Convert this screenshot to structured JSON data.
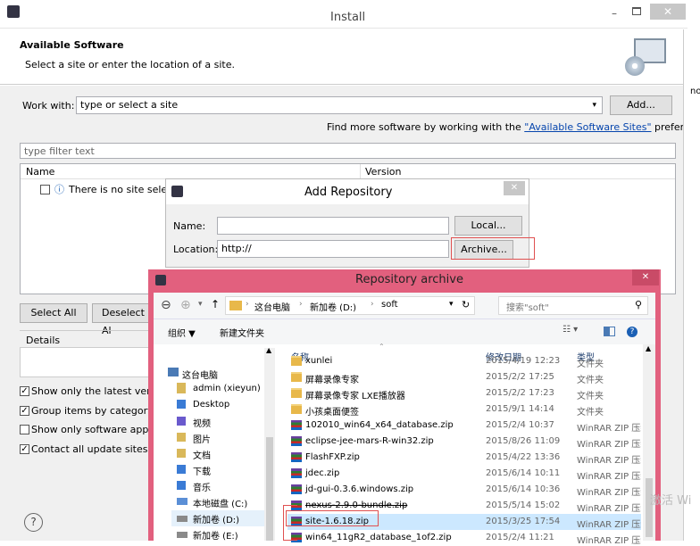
{
  "install": {
    "title": "Install",
    "header_title": "Available Software",
    "header_subtitle": "Select a site or enter the location of a site.",
    "work_with_label": "Work with:",
    "work_with_value": "type or select a site",
    "add_button": "Add...",
    "find_more_prefix": "Find more software by working with the ",
    "find_more_link": "\"Available Software Sites\"",
    "find_more_suffix": " preferences.",
    "filter_placeholder": "type filter text",
    "col_name": "Name",
    "col_version": "Version",
    "no_site_text": "There is no site select",
    "select_all": "Select All",
    "deselect_all": "Deselect Al",
    "details_label": "Details",
    "options": [
      {
        "label": "Show only the latest versio",
        "checked": true
      },
      {
        "label": "Group items by category",
        "checked": true
      },
      {
        "label": "Show only software applica",
        "checked": false
      },
      {
        "label": "Contact all update sites du",
        "checked": true
      }
    ],
    "help_glyph": "?",
    "right_fragment": "no"
  },
  "add_repository": {
    "title": "Add Repository",
    "name_label": "Name:",
    "name_value": "",
    "location_label": "Location:",
    "location_value": "http://",
    "local_button": "Local...",
    "archive_button": "Archive..."
  },
  "archive_dialog": {
    "title": "Repository archive",
    "breadcrumb": [
      "这台电脑",
      "新加卷 (D:)",
      "soft"
    ],
    "search_placeholder": "搜索\"soft\"",
    "organize": "组织 ▼",
    "new_folder": "新建文件夹",
    "col_name": "名称",
    "col_date": "修改日期",
    "col_type": "类型",
    "nav": [
      "这台电脑",
      "admin (xieyun)",
      "Desktop",
      "视频",
      "图片",
      "文档",
      "下载",
      "音乐",
      "本地磁盘 (C:)",
      "新加卷 (D:)",
      "新加卷 (E:)"
    ],
    "files": [
      {
        "name": "xunlei",
        "date": "2015/4/19 12:23",
        "type": "文件夹",
        "kind": "folder"
      },
      {
        "name": "屏幕录像专家",
        "date": "2015/2/2 17:25",
        "type": "文件夹",
        "kind": "folder"
      },
      {
        "name": "屏幕录像专家 LXE播放器",
        "date": "2015/2/2 17:23",
        "type": "文件夹",
        "kind": "folder"
      },
      {
        "name": "小孩桌面便签",
        "date": "2015/9/1 14:14",
        "type": "文件夹",
        "kind": "folder"
      },
      {
        "name": "102010_win64_x64_database.zip",
        "date": "2015/2/4 10:37",
        "type": "WinRAR ZIP 压缩",
        "kind": "zip"
      },
      {
        "name": "eclipse-jee-mars-R-win32.zip",
        "date": "2015/8/26 11:09",
        "type": "WinRAR ZIP 压缩",
        "kind": "zip"
      },
      {
        "name": "FlashFXP.zip",
        "date": "2015/4/22 13:36",
        "type": "WinRAR ZIP 压缩",
        "kind": "zip"
      },
      {
        "name": "jdec.zip",
        "date": "2015/6/14 10:11",
        "type": "WinRAR ZIP 压缩",
        "kind": "zip"
      },
      {
        "name": "jd-gui-0.3.6.windows.zip",
        "date": "2015/6/14 10:36",
        "type": "WinRAR ZIP 压缩",
        "kind": "zip"
      },
      {
        "name": "nexus-2.9.0-bundle.zip",
        "date": "2015/5/14 15:02",
        "type": "WinRAR ZIP 压缩",
        "kind": "zip"
      },
      {
        "name": "site-1.6.18.zip",
        "date": "2015/3/25 17:54",
        "type": "WinRAR ZIP 压缩",
        "kind": "zip"
      },
      {
        "name": "win64_11gR2_database_1of2.zip",
        "date": "2015/2/4 11:21",
        "type": "WinRAR ZIP 压缩",
        "kind": "zip"
      }
    ],
    "watermark": "激活 Wi"
  },
  "colors": {
    "archive_title_bg": "#e2607e",
    "highlight_box": "#e05050",
    "link": "#0645ad"
  }
}
